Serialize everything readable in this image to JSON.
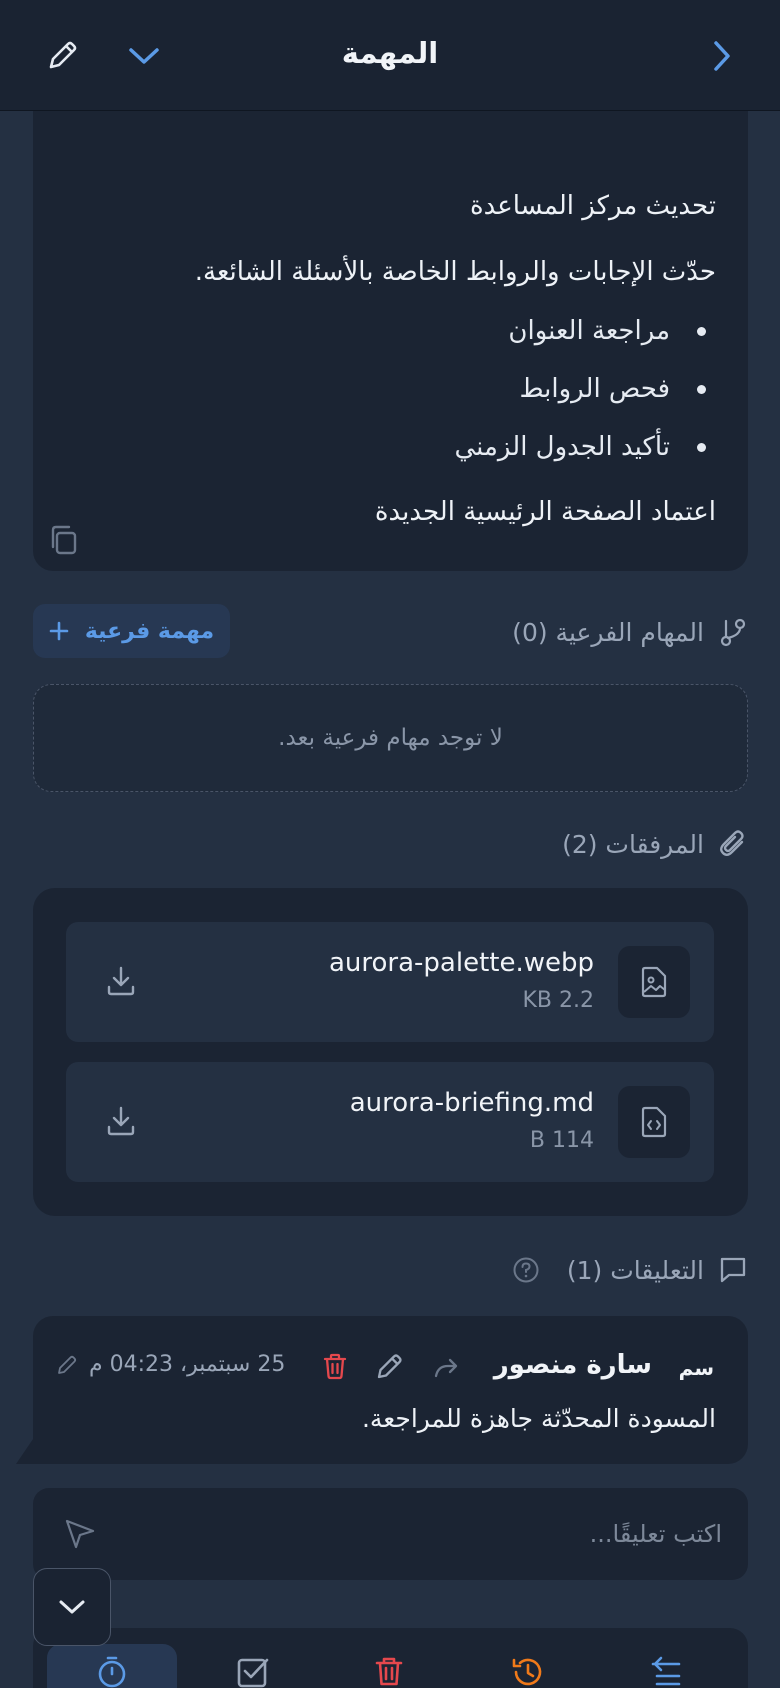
{
  "header": {
    "title": "المهمة"
  },
  "description": {
    "heading": "تحديث مركز المساعدة",
    "body": "حدّث الإجابات والروابط الخاصة بالأسئلة الشائعة.",
    "checklist": [
      "مراجعة العنوان",
      "فحص الروابط",
      "تأكيد الجدول الزمني"
    ],
    "footer": "اعتماد الصفحة الرئيسية الجديدة"
  },
  "subtasks": {
    "title": "المهام الفرعية (0)",
    "add_label": "مهمة فرعية",
    "empty_message": "لا توجد مهام فرعية بعد."
  },
  "attachments": {
    "title": "المرفقات (2)",
    "items": [
      {
        "name": "aurora-palette.webp",
        "size": "KB 2.2",
        "icon": "image-file-icon"
      },
      {
        "name": "aurora-briefing.md",
        "size": "B 114",
        "icon": "code-file-icon"
      }
    ]
  },
  "comments": {
    "title": "التعليقات (1)",
    "items": [
      {
        "initials": "سم",
        "author": "سارة منصور",
        "timestamp": "25 سبتمبر، 04:23 م",
        "text": "المسودة المحدّثة جاهزة للمراجعة."
      }
    ],
    "input_placeholder": "اكتب تعليقًا..."
  },
  "colors": {
    "accent": "#5b9ae6",
    "danger": "#e5484d",
    "warning": "#f07a1a",
    "background": "#243042",
    "card": "#1b2433"
  }
}
